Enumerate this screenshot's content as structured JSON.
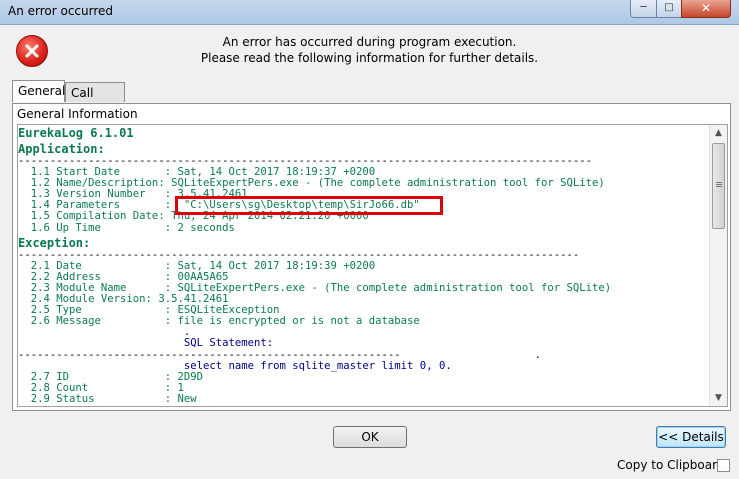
{
  "window": {
    "title": "An error occurred"
  },
  "title_buttons": {
    "minimize": "─",
    "maximize": "□",
    "close": "✕"
  },
  "header": {
    "message_line1": "An error has occurred during program execution.",
    "message_line2": "Please read the following information for further details."
  },
  "tabs": [
    {
      "label": "General",
      "active": true
    },
    {
      "label": "Call Stack",
      "active": false
    }
  ],
  "panel": {
    "group_label": "General Information",
    "log_lines": [
      "EurekaLog 6.1.01",
      "",
      "Application:",
      "------------------------------------------------------------------------------------------",
      "  1.1 Start Date       : Sat, 14 Oct 2017 18:19:37 +0200",
      "  1.2 Name/Description: SQLiteExpertPers.exe - (The complete administration tool for SQLite)",
      "  1.3 Version Number   : 3.5.41.2461",
      "  1.4 Parameters       :  \"C:\\Users\\sg\\Desktop\\temp\\SirJo66.db\"",
      "  1.5 Compilation Date: Thu, 24 Apr 2014 02:21:20 +0000",
      "  1.6 Up Time          : 2 seconds",
      "",
      "Exception:",
      "----------------------------------------------------------------------------------------",
      "  2.1 Date             : Sat, 14 Oct 2017 18:19:39 +0200",
      "  2.2 Address          : 00AA5A65",
      "  2.3 Module Name      : SQLiteExpertPers.exe - (The complete administration tool for SQLite)",
      "  2.4 Module Version: 3.5.41.2461",
      "  2.5 Type             : ESQLiteException",
      "  2.6 Message          : file is encrypted or is not a database",
      "                          .",
      "                          SQL Statement:",
      "------------------------------------------------------------                     .",
      "                          select name from sqlite_master limit 0, 0.",
      "  2.7 ID               : 2D9D",
      "  2.8 Count            : 1",
      "  2.9 Status           : New"
    ]
  },
  "scrollbar": {
    "up": "▲",
    "down": "▼"
  },
  "buttons": {
    "ok_label": "OK",
    "details_label": "<< Details"
  },
  "copy_clipboard": {
    "label": "Copy to Clipboard",
    "checked": false
  },
  "colors": {
    "header_green": "#0b7a4e",
    "value_blue": "#00008b",
    "highlight_red": "#e0000b"
  }
}
